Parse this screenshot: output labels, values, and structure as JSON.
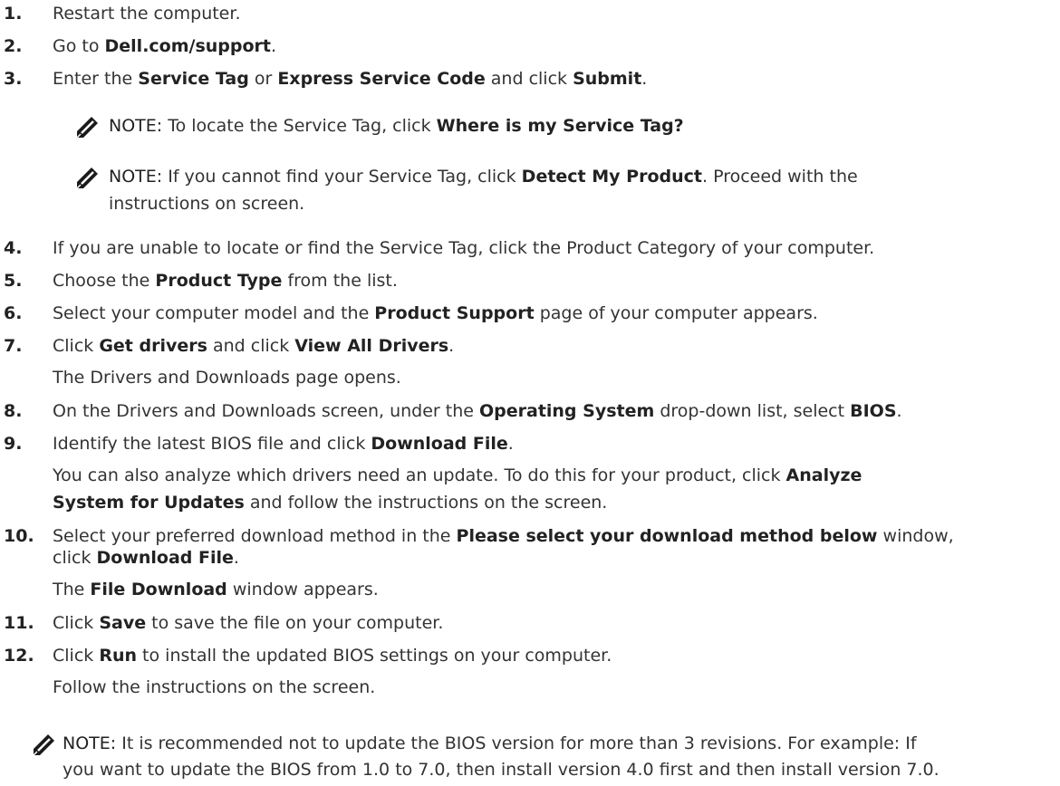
{
  "steps": [
    {
      "num": "1.",
      "parts": [
        {
          "t": "Restart the computer."
        }
      ]
    },
    {
      "num": "2.",
      "parts": [
        {
          "t": "Go to "
        },
        {
          "t": "Dell.com/support",
          "b": true
        },
        {
          "t": "."
        }
      ]
    },
    {
      "num": "3.",
      "parts": [
        {
          "t": "Enter the "
        },
        {
          "t": "Service Tag",
          "b": true
        },
        {
          "t": " or "
        },
        {
          "t": "Express Service Code",
          "b": true
        },
        {
          "t": " and click "
        },
        {
          "t": "Submit",
          "b": true
        },
        {
          "t": "."
        }
      ]
    },
    {
      "num": "4.",
      "parts": [
        {
          "t": "If you are unable to locate or find the Service Tag, click the Product Category of your computer."
        }
      ]
    },
    {
      "num": "5.",
      "parts": [
        {
          "t": "Choose the "
        },
        {
          "t": "Product Type",
          "b": true
        },
        {
          "t": " from the list."
        }
      ]
    },
    {
      "num": "6.",
      "parts": [
        {
          "t": "Select your computer model and the "
        },
        {
          "t": "Product Support",
          "b": true
        },
        {
          "t": " page of your computer appears."
        }
      ]
    },
    {
      "num": "7.",
      "parts": [
        {
          "t": "Click "
        },
        {
          "t": "Get drivers",
          "b": true
        },
        {
          "t": " and click "
        },
        {
          "t": "View All Drivers",
          "b": true
        },
        {
          "t": "."
        }
      ]
    },
    {
      "num": "8.",
      "parts": [
        {
          "t": "On the Drivers and Downloads screen, under the "
        },
        {
          "t": "Operating System",
          "b": true
        },
        {
          "t": " drop-down list, select "
        },
        {
          "t": "BIOS",
          "b": true
        },
        {
          "t": "."
        }
      ]
    },
    {
      "num": "9.",
      "parts": [
        {
          "t": "Identify the latest BIOS file and click "
        },
        {
          "t": "Download File",
          "b": true
        },
        {
          "t": "."
        }
      ]
    },
    {
      "num": "10.",
      "parts": [
        {
          "t": "Select your preferred download method in the "
        },
        {
          "t": "Please select your download method below",
          "b": true
        },
        {
          "t": " window,"
        }
      ]
    },
    {
      "num": "11.",
      "parts": [
        {
          "t": "Click "
        },
        {
          "t": "Save",
          "b": true
        },
        {
          "t": " to save the file on your computer."
        }
      ]
    },
    {
      "num": "12.",
      "parts": [
        {
          "t": "Click "
        },
        {
          "t": "Run",
          "b": true
        },
        {
          "t": " to install the updated BIOS settings on your computer."
        }
      ]
    }
  ],
  "paras": {
    "p7": [
      {
        "t": "The Drivers and Downloads page opens."
      }
    ],
    "p9a": [
      {
        "t": "You can also analyze which drivers need an update. To do this for your product, click "
      },
      {
        "t": "Analyze",
        "b": true
      }
    ],
    "p9b": [
      {
        "t": "System for Updates",
        "b": true
      },
      {
        "t": " and follow the instructions on the screen."
      }
    ],
    "p10a": [
      {
        "t": "click "
      },
      {
        "t": "Download File",
        "b": true
      },
      {
        "t": "."
      }
    ],
    "p10b": [
      {
        "t": "The "
      },
      {
        "t": "File Download",
        "b": true
      },
      {
        "t": " window appears."
      }
    ],
    "p12": [
      {
        "t": "Follow the instructions on the screen."
      }
    ]
  },
  "notes": {
    "n1": [
      [
        {
          "t": "NOTE:",
          "label": true
        },
        {
          "t": " To locate the Service Tag, click "
        },
        {
          "t": "Where is my Service Tag?",
          "b": true
        }
      ]
    ],
    "n2": [
      [
        {
          "t": "NOTE:",
          "label": true
        },
        {
          "t": " If you cannot find your Service Tag, click "
        },
        {
          "t": "Detect My Product",
          "b": true
        },
        {
          "t": ". Proceed with the"
        }
      ],
      [
        {
          "t": "instructions on screen."
        }
      ]
    ],
    "n3": [
      [
        {
          "t": "NOTE:",
          "label": true
        },
        {
          "t": " It is recommended not to update the BIOS version for more than 3 revisions. For example: If"
        }
      ],
      [
        {
          "t": "you want to update the BIOS from 1.0 to 7.0, then install version 4.0 first and then install version 7.0."
        }
      ]
    ]
  }
}
